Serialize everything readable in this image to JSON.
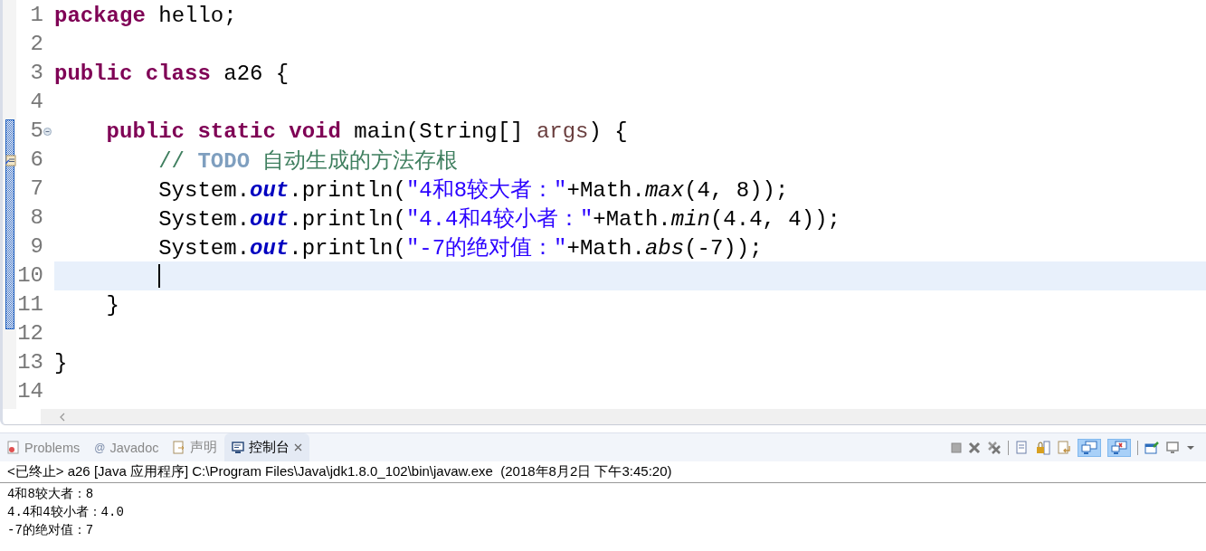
{
  "editor": {
    "lines": [
      {
        "number": "1",
        "current": false,
        "tokens": [
          {
            "kind": "keyword",
            "text": "package"
          },
          {
            "kind": "plain",
            "text": " hello;"
          }
        ]
      },
      {
        "number": "2",
        "current": false
      },
      {
        "number": "3",
        "current": false,
        "tokens": [
          {
            "kind": "keyword",
            "text": "public class"
          },
          {
            "kind": "plain",
            "text": " a26 {"
          }
        ],
        "children": [
          {
            "number": "4",
            "current": false
          },
          {
            "number": "5",
            "current": false,
            "fold": true,
            "tokens": [
              {
                "kind": "keyword",
                "text": "public static void"
              },
              {
                "kind": "plain",
                "text": " main(String[] "
              },
              {
                "kind": "param",
                "text": "args"
              },
              {
                "kind": "plain",
                "text": ") {"
              }
            ],
            "children": [
              {
                "number": "6",
                "current": false,
                "task": true,
                "tokens": [
                  {
                    "kind": "comment",
                    "text": "// "
                  },
                  {
                    "kind": "todo",
                    "text": "TODO"
                  },
                  {
                    "kind": "comment",
                    "text": " 自动生成的方法存根"
                  }
                ]
              },
              {
                "number": "7",
                "current": false,
                "tokens": [
                  {
                    "kind": "plain",
                    "text": "System."
                  },
                  {
                    "kind": "field",
                    "text": "out"
                  },
                  {
                    "kind": "plain",
                    "text": ".println("
                  },
                  {
                    "kind": "string",
                    "text": "\"4和8较大者：\""
                  },
                  {
                    "kind": "plain",
                    "text": "+Math."
                  },
                  {
                    "kind": "static",
                    "text": "max"
                  },
                  {
                    "kind": "plain",
                    "text": "(4, 8));"
                  }
                ]
              },
              {
                "number": "8",
                "current": false,
                "tokens": [
                  {
                    "kind": "plain",
                    "text": "System."
                  },
                  {
                    "kind": "field",
                    "text": "out"
                  },
                  {
                    "kind": "plain",
                    "text": ".println("
                  },
                  {
                    "kind": "string",
                    "text": "\"4.4和4较小者：\""
                  },
                  {
                    "kind": "plain",
                    "text": "+Math."
                  },
                  {
                    "kind": "static",
                    "text": "min"
                  },
                  {
                    "kind": "plain",
                    "text": "(4.4, 4));"
                  }
                ]
              },
              {
                "number": "9",
                "current": false,
                "tokens": [
                  {
                    "kind": "plain",
                    "text": "System."
                  },
                  {
                    "kind": "field",
                    "text": "out"
                  },
                  {
                    "kind": "plain",
                    "text": ".println("
                  },
                  {
                    "kind": "string",
                    "text": "\"-7的绝对值：\""
                  },
                  {
                    "kind": "plain",
                    "text": "+Math."
                  },
                  {
                    "kind": "static",
                    "text": "abs"
                  },
                  {
                    "kind": "plain",
                    "text": "(-7));"
                  }
                ]
              },
              {
                "number": "10",
                "current": true
              }
            ]
          },
          {
            "number": "11",
            "current": false,
            "tokens": [
              {
                "kind": "plain",
                "text": "}"
              }
            ]
          },
          {
            "number": "12",
            "current": false
          }
        ]
      },
      {
        "number": "13",
        "current": false,
        "tokens": [
          {
            "kind": "plain",
            "text": "}"
          }
        ]
      },
      {
        "number": "14",
        "current": false
      }
    ]
  },
  "bottom_panel": {
    "tabs": [
      {
        "label": "Problems",
        "selected": false
      },
      {
        "glyph": "@",
        "label": "Javadoc",
        "selected": false
      },
      {
        "label": "声明",
        "selected": false
      },
      {
        "label": "控制台",
        "selected": true,
        "closable": true
      }
    ],
    "console": {
      "header": "<已终止> a26 [Java 应用程序] C:\\Program Files\\Java\\jdk1.8.0_102\\bin\\javaw.exe  (2018年8月2日 下午3:45:20)",
      "output": [
        "4和8较大者：8",
        "4.4和4较小者：4.0",
        "-7的绝对值：7"
      ]
    }
  }
}
